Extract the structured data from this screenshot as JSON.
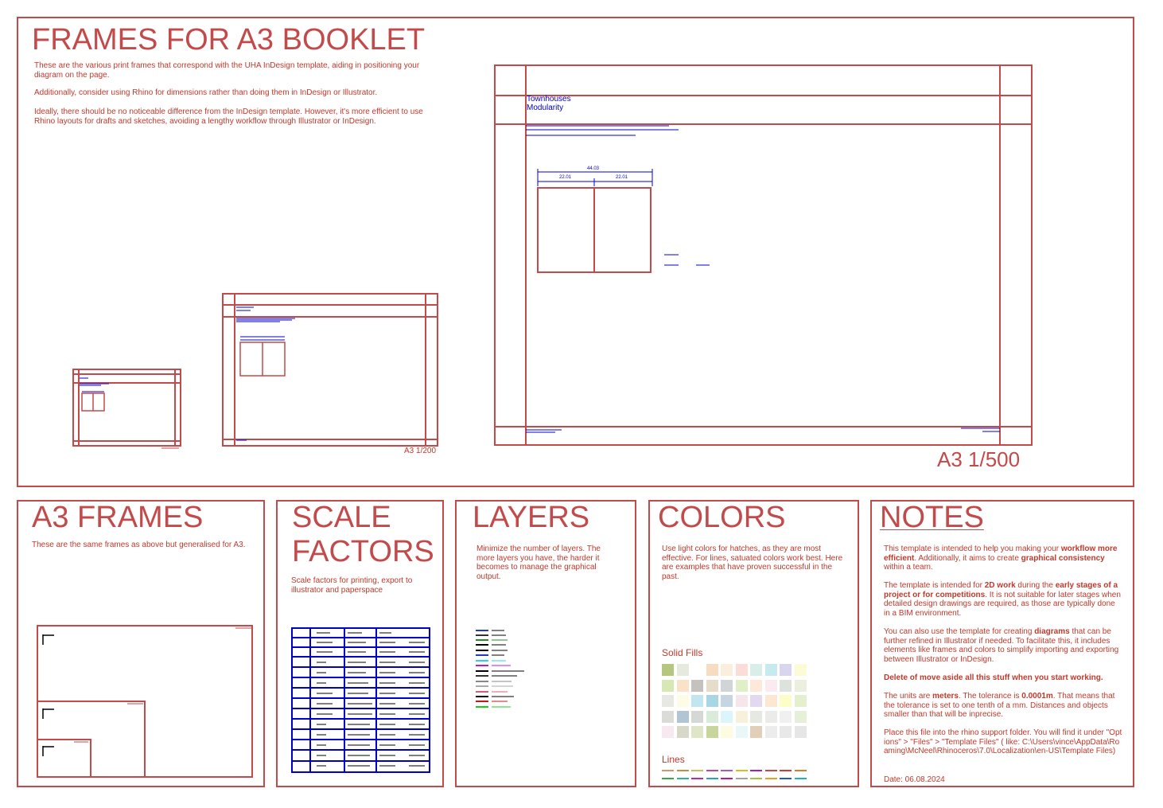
{
  "top": {
    "title": "FRAMES FOR A3 BOOKLET",
    "para1": "These are the various print frames that correspond with the UHA InDesign template, aiding in positioning your diagram on the page.",
    "para2": "Additionally, consider using Rhino for dimensions rather than doing them in InDesign or Illustrator.",
    "para3": "Ideally, there should be no noticeable difference from the InDesign template. However, it's more efficient to use Rhino layouts for drafts and sketches, avoiding a lengthy workflow through Illustrator or InDesign.",
    "label_mid": "A3 1/200",
    "label_big": "A3 1/500",
    "frame_text_1": "Townhouses",
    "frame_text_2": "Modularity",
    "dim_total": "44.03",
    "dim_left": "22.01",
    "dim_right": "22.01"
  },
  "a3frames": {
    "title": "A3 FRAMES",
    "desc": "These are the same frames as above but generalised for A3."
  },
  "scale": {
    "title_line1": "SCALE",
    "title_line2": "FACTORS",
    "desc": "Scale factors for printing, export to illustrator and paperspace"
  },
  "layers": {
    "title": "LAYERS",
    "desc": "Minimize the number of layers. The more layers you have, the harder it becomes to manage the graphical output."
  },
  "colors": {
    "title": "COLORS",
    "desc": "Use light colors for hatches, as they are most effective. For lines, satuated colors work best. Here are examples that have proven successful in the past.",
    "solid_fills_label": "Solid Fills",
    "lines_label": "Lines",
    "fills": [
      [
        "#b5c77f",
        "#e6e9de",
        "#ffffff",
        "#f8dcc2",
        "#fbeedd",
        "#fbdcd6",
        "#d8efe9",
        "#c7e9f0",
        "#d9d5ee",
        "#fdfbd5"
      ],
      [
        "#d8e8b5",
        "#fbe1c5",
        "#c5c1bd",
        "#e6dcca",
        "#d2d5d8",
        "#e1efc9",
        "#fde8da",
        "#fbeaf0",
        "#dde2dc",
        "#eaf0dd"
      ],
      [
        "#e8e8e2",
        "#fdfde6",
        "#c1e6f0",
        "#a9d6e5",
        "#c5d6e2",
        "#f6e6ec",
        "#e3d9ee",
        "#fce8d2",
        "#fdfdc8",
        "#e3efcd"
      ],
      [
        "#dbdcd8",
        "#b1c5d2",
        "#d5d8d5",
        "#d8ecd9",
        "#dcf5fb",
        "#f8f0da",
        "#e6e8e2",
        "#ebebea",
        "#f0f0f0",
        "#e6efd8"
      ],
      [
        "#f8e8ef",
        "#d8d8c8",
        "#dfe6c8",
        "#c8d59b",
        "#fdfbe0",
        "#eaf7f8",
        "#e3cfb7",
        "#ececec",
        "#e8e8e8",
        "#e6e6e6"
      ]
    ],
    "lines_row1": [
      "#c79b6e",
      "#c28e3f",
      "#c9c05a",
      "#c24a8b",
      "#a35bc5",
      "#d6c020",
      "#a322b5",
      "#c24a4a",
      "#d6392b",
      "#d67f2b"
    ],
    "lines_row2": [
      "#3aa54a",
      "#26b5a0",
      "#c22a9b",
      "#2aa0c5",
      "#c2188f",
      "#a3a3a3",
      "#a4c53a",
      "#e6a21e",
      "#1f5bc5",
      "#16b5c0"
    ]
  },
  "notes": {
    "title": "NOTES",
    "p1_a": "This template is intended to help you making your ",
    "p1_b": "workflow more efficient",
    "p1_c": ". Additionally, it aims to create ",
    "p1_d": "graphical consistency",
    "p1_e": " within a team.",
    "p2_a": "The template is intended for ",
    "p2_b": "2D work",
    "p2_c": " during the ",
    "p2_d": "early stages of a project or for competitions",
    "p2_e": ". It is not suitable for later stages when detailed design drawings are required, as those are typically done in a BIM environment.",
    "p3_a": "You can also use the template for creating ",
    "p3_b": "diagrams",
    "p3_c": " that can be further refined in Illustrator if needed. To facilitate this, it includes elements like frames and colors to simplify importing and exporting between Illustrator or InDesign.",
    "p4": "Delete of move aside all this stuff when you start working.",
    "p5_a": "The units are ",
    "p5_b": "meters",
    "p5_c": ". The tolerance is ",
    "p5_d": "0.0001m",
    "p5_e": ". That means that the tolerance is set to one tenth of a mm. Distances and objects smaller than that will be inprecise.",
    "p6": "Place this file into the rhino support folder. You will find it under \"Options\" >  \"Files\" > \"Template Files\" ( like: C:\\Users\\vince\\AppData\\Roaming\\McNeel\\Rhinoceros\\7.0\\Localization\\en-US\\Template Files)",
    "date": "Date: 06.08.2024"
  }
}
